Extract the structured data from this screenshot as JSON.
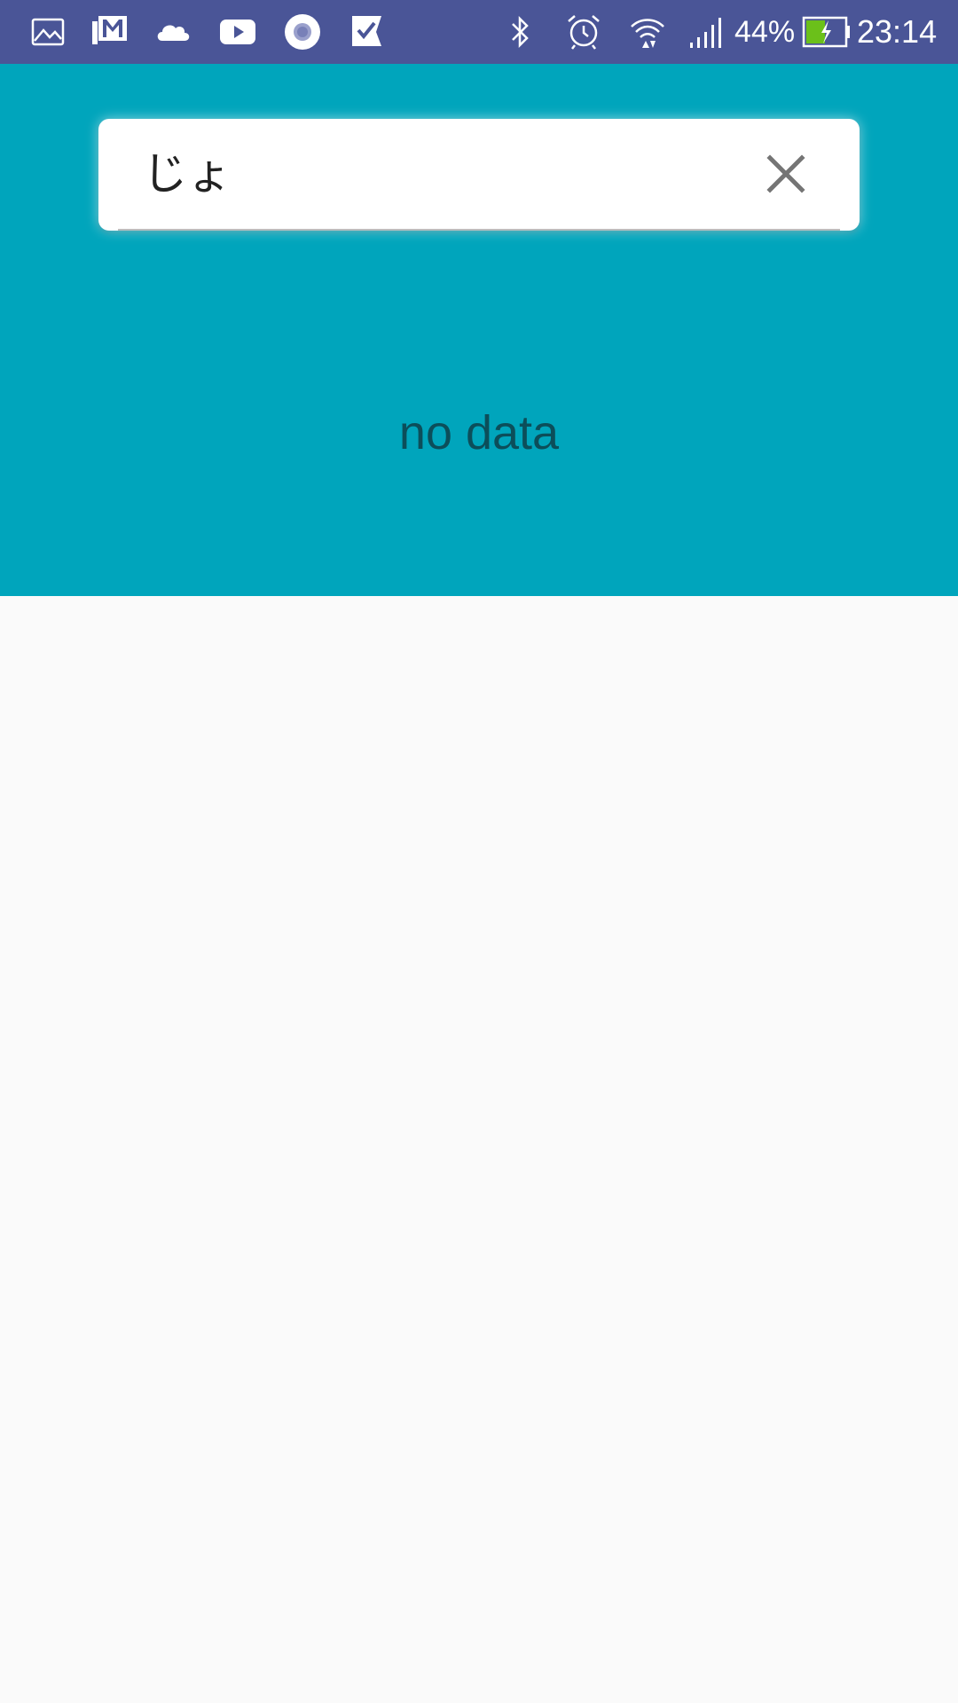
{
  "status_bar": {
    "background": "#4a5597",
    "left_icons": [
      "gallery-icon",
      "gmail-icon",
      "cloud-icon",
      "youtube-icon",
      "record-icon",
      "check-flag-icon"
    ],
    "right_icons": [
      "bluetooth-icon",
      "alarm-icon",
      "wifi-icon",
      "signal-icon",
      "battery-charging-icon"
    ],
    "battery_percent": "44%",
    "time": "23:14"
  },
  "header": {
    "background": "#00a5bc"
  },
  "search": {
    "value": "じょ",
    "clear_icon": "close-icon"
  },
  "results": {
    "empty_message": "no data",
    "text_color": "#0c4e5a"
  },
  "content": {
    "background": "#fafafa"
  }
}
